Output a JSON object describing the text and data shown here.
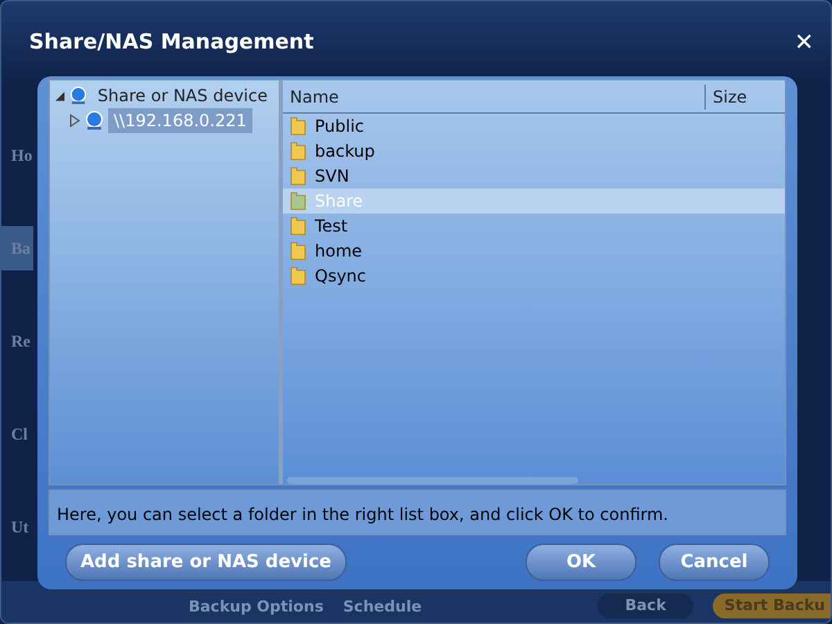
{
  "window": {
    "title": "Share/NAS Management",
    "close": "✕"
  },
  "background": {
    "sidebar": [
      {
        "label": "Ho",
        "selected": false
      },
      {
        "label": "Ba",
        "selected": true
      },
      {
        "label": "Re",
        "selected": false
      },
      {
        "label": "Cl",
        "selected": false
      },
      {
        "label": "Ut",
        "selected": false
      }
    ],
    "bottom_bar": {
      "options": "Backup Options",
      "schedule": "Schedule",
      "back": "Back",
      "start": "Start Backu"
    }
  },
  "tree": [
    {
      "label": "Share or NAS device",
      "expanded": true,
      "selected": false,
      "children": [
        {
          "label": "\\\\192.168.0.221",
          "expanded": false,
          "selected": true
        }
      ]
    }
  ],
  "list": {
    "columns": [
      "Name",
      "Size"
    ],
    "rows": [
      {
        "name": "Public",
        "selected": false
      },
      {
        "name": "backup",
        "selected": false
      },
      {
        "name": "SVN",
        "selected": false
      },
      {
        "name": "Share",
        "selected": true
      },
      {
        "name": "Test",
        "selected": false
      },
      {
        "name": "home",
        "selected": false
      },
      {
        "name": "Qsync",
        "selected": false
      }
    ]
  },
  "hint": "Here, you can select a folder in the right list box, and click OK to confirm.",
  "buttons": {
    "add": "Add share or NAS device",
    "ok": "OK",
    "cancel": "Cancel"
  }
}
